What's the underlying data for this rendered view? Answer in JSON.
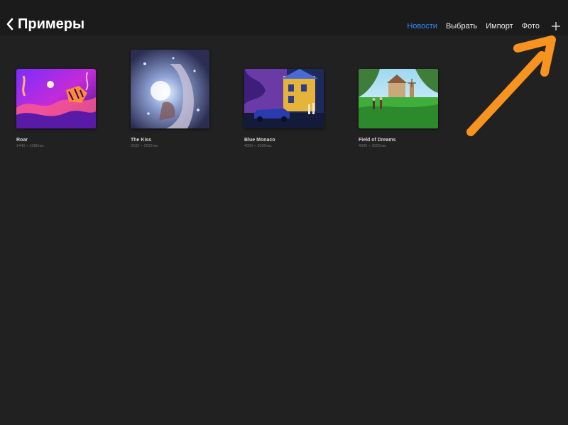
{
  "header": {
    "title": "Примеры",
    "nav": [
      {
        "label": "Новости",
        "active": true
      },
      {
        "label": "Выбрать",
        "active": false
      },
      {
        "label": "Импорт",
        "active": false
      },
      {
        "label": "Фото",
        "active": false
      }
    ]
  },
  "artworks": [
    {
      "title": "Roar",
      "size": "1440 × 1080пкс"
    },
    {
      "title": "The Kiss",
      "size": "2632 × 2632пкс"
    },
    {
      "title": "Blue Monaco",
      "size": "4000 × 3000пкс"
    },
    {
      "title": "Field of Dreams",
      "size": "4000 × 3000пкс"
    }
  ],
  "colors": {
    "background": "#212121",
    "topbar": "#1b1b1b",
    "accent": "#2d8cff",
    "annotation_arrow": "#f7931e"
  },
  "icons": {
    "back": "chevron-left-icon",
    "add": "plus-icon"
  }
}
